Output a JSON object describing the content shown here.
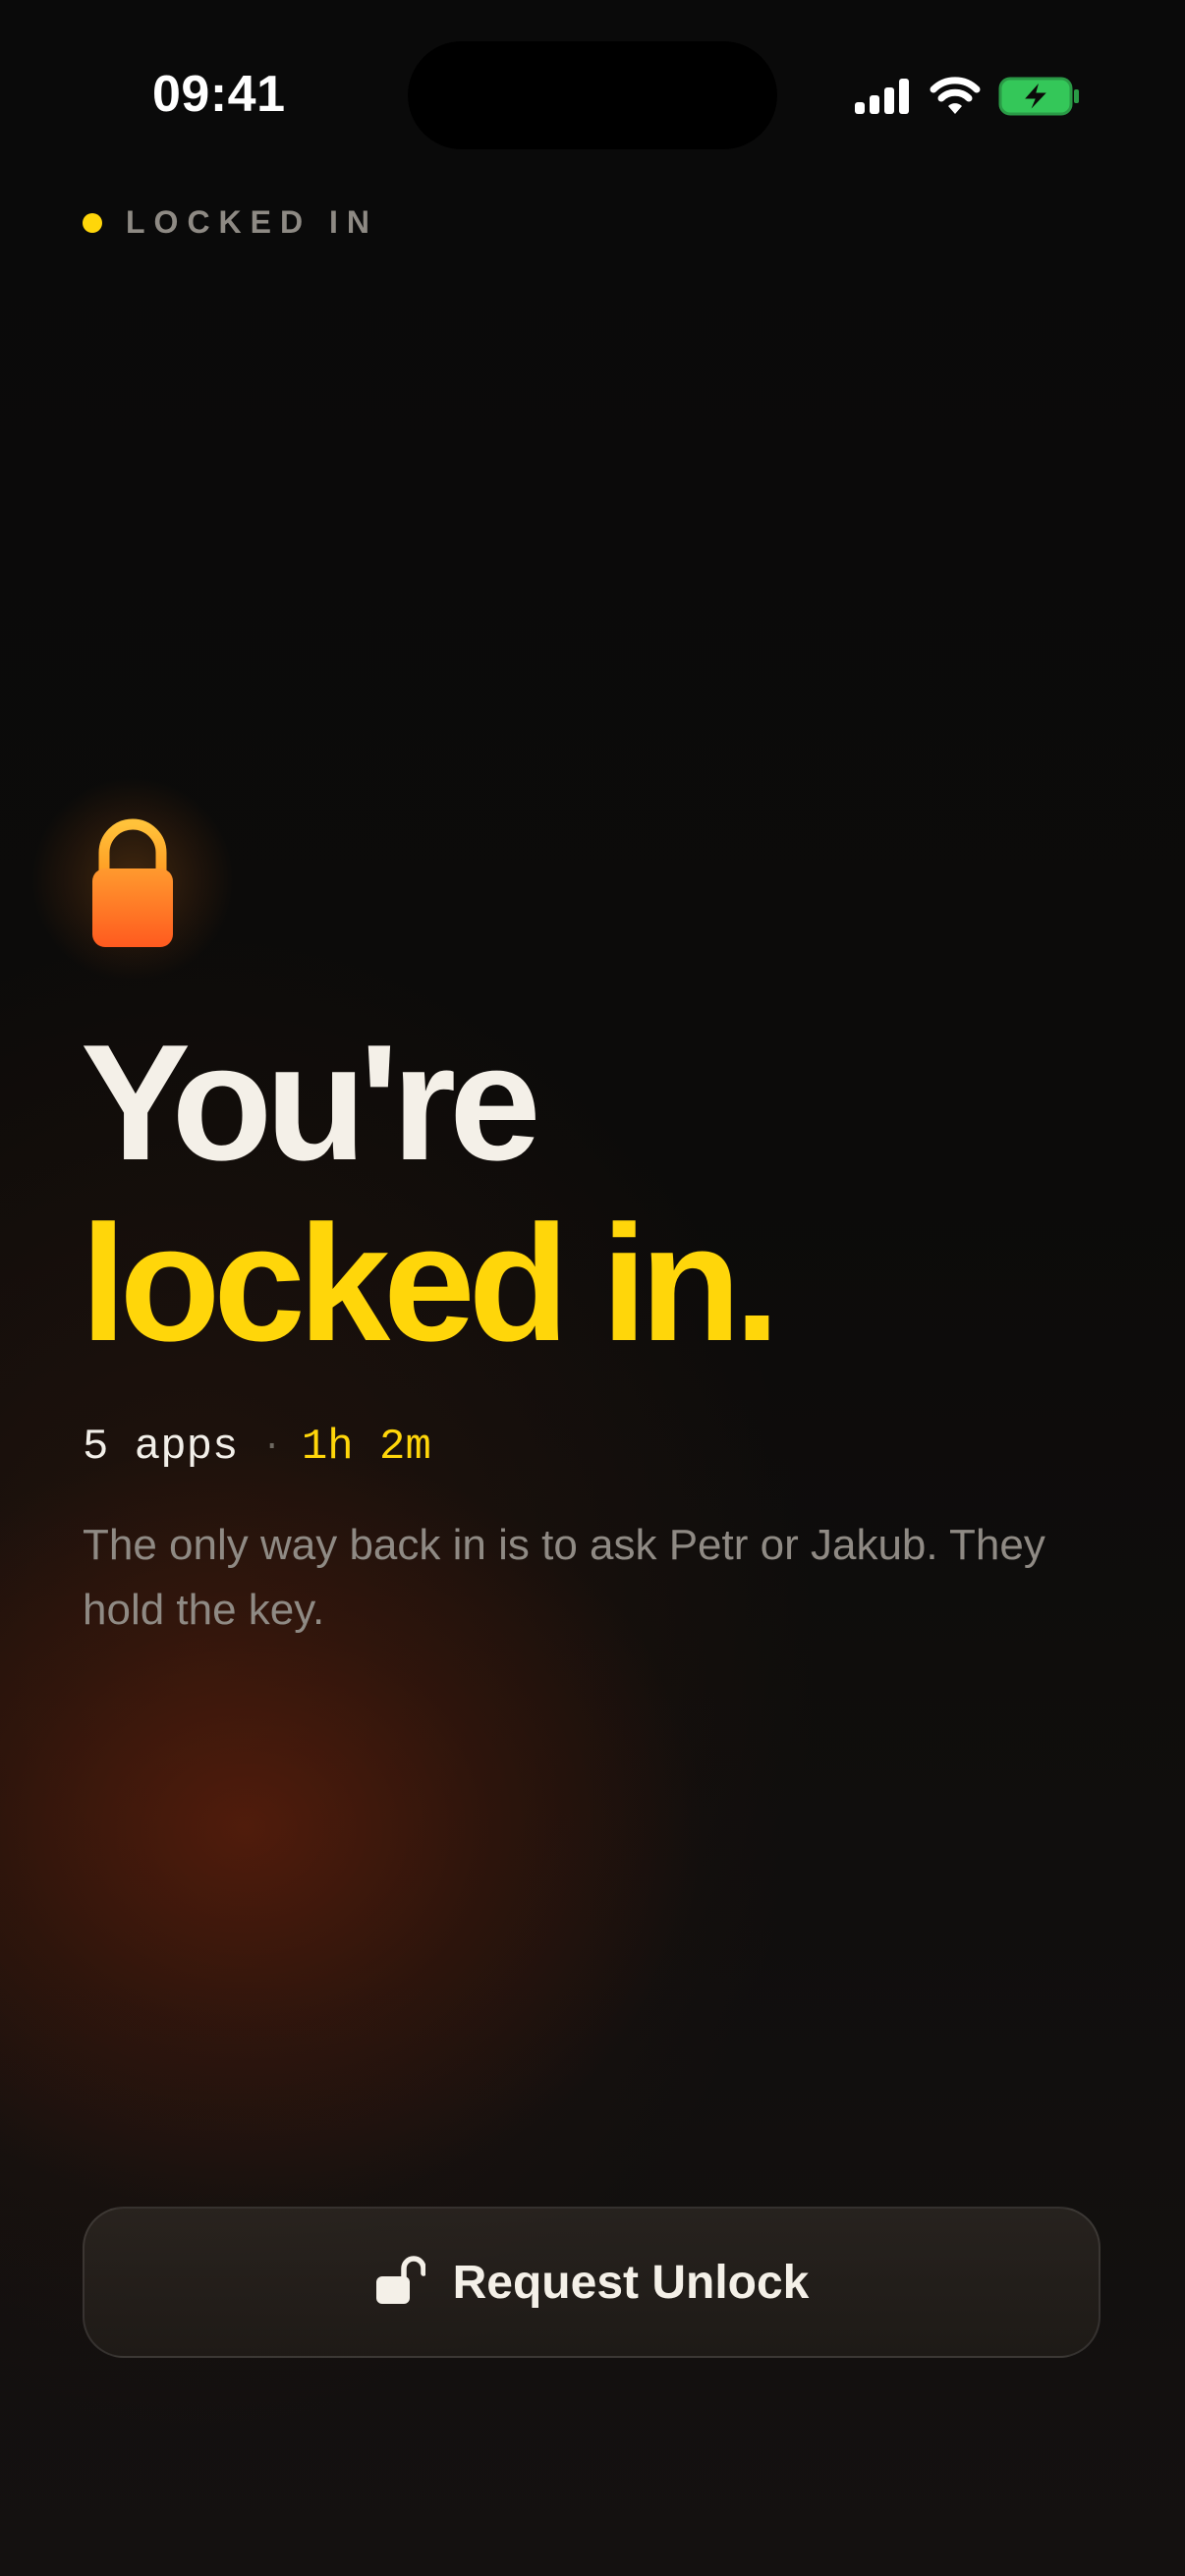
{
  "status_bar": {
    "time": "09:41"
  },
  "header": {
    "status_label": "LOCKED IN",
    "status_dot_color": "#ffd60a"
  },
  "hero": {
    "icon": "lock-icon",
    "title_line1": "You're",
    "title_line2": "locked in.",
    "accent_color": "#ffd60a"
  },
  "stats": {
    "apps": "5 apps",
    "separator": "·",
    "duration": "1h 2m"
  },
  "description": "The only way back in is to ask Petr or Jakub. They hold the key.",
  "action": {
    "label": "Request Unlock",
    "icon": "unlock-icon"
  }
}
